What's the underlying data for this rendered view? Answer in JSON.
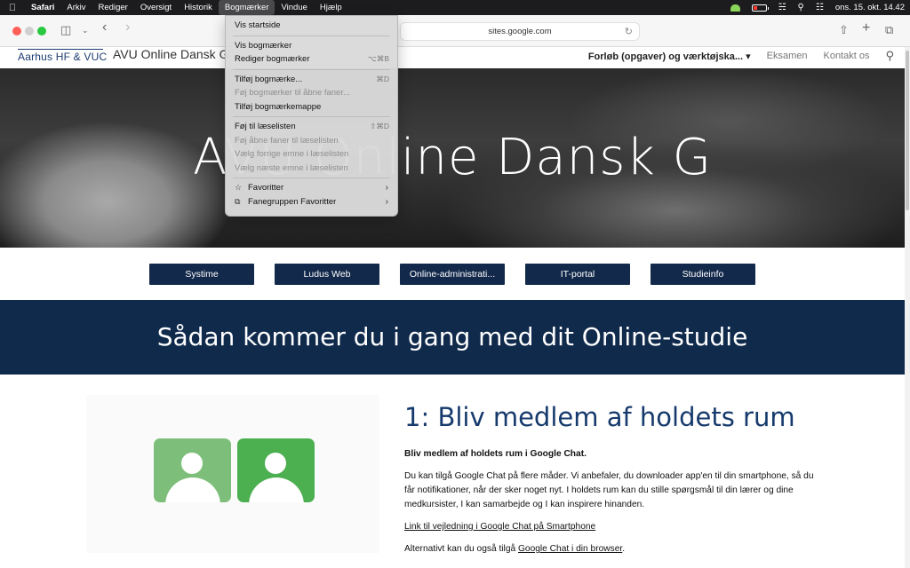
{
  "menubar": {
    "apple": "",
    "items": [
      "Safari",
      "Arkiv",
      "Rediger",
      "Oversigt",
      "Historik",
      "Bogmærker",
      "Vindue",
      "Hjælp"
    ],
    "clock": "ons. 15. okt. 14.42"
  },
  "browser": {
    "url": "sites.google.com"
  },
  "site": {
    "logo": "Aarhus HF & VUC",
    "title": "AVU Online Dansk G",
    "nav": [
      "Forløb (opgaver) og værktøjska...",
      "Eksamen",
      "Kontakt os"
    ],
    "hero_title": "AVU Online Dansk G",
    "buttons": [
      "Systime",
      "Ludus Web",
      "Online-administrati...",
      "IT-portal",
      "Studieinfo"
    ],
    "banner": "Sådan kommer du i gang med dit Online-studie",
    "section": {
      "heading": "1: Bliv medlem af holdets rum",
      "lead": "Bliv medlem af holdets rum i Google Chat.",
      "body": "Du kan tilgå Google Chat på flere måder. Vi anbefaler, du downloader app'en til din smartphone, så du får notifikationer, når der sker noget nyt. I holdets rum kan du stille spørgsmål til din lærer og dine medkursister, I kan samarbejde og I kan inspirere hinanden.",
      "link1": "Link til vejledning i Google Chat på Smartphone",
      "alt_prefix": "Alternativt kan du også tilgå ",
      "alt_link": "Google Chat i din browser",
      "alt_suffix": "."
    }
  },
  "menu": {
    "show_start": "Vis startside",
    "show_bookmarks": "Vis bogmærker",
    "edit_bookmarks": "Rediger bogmærker",
    "edit_bookmarks_sc": "⌥⌘B",
    "add_bookmark": "Tilføj bogmærke...",
    "add_bookmark_sc": "⌘D",
    "add_to_open_tabs": "Føj bogmærker til åbne faner...",
    "add_folder": "Tilføj bogmærkemappe",
    "add_reading": "Føj til læselisten",
    "add_reading_sc": "⇧⌘D",
    "add_open_tabs_reading": "Føj åbne faner til læselisten",
    "prev_reading": "Vælg forrige emne i læselisten",
    "next_reading": "Vælg næste emne i læselisten",
    "favorites": "Favoritter",
    "tabgroup_favorites": "Fanegruppen Favoritter"
  }
}
